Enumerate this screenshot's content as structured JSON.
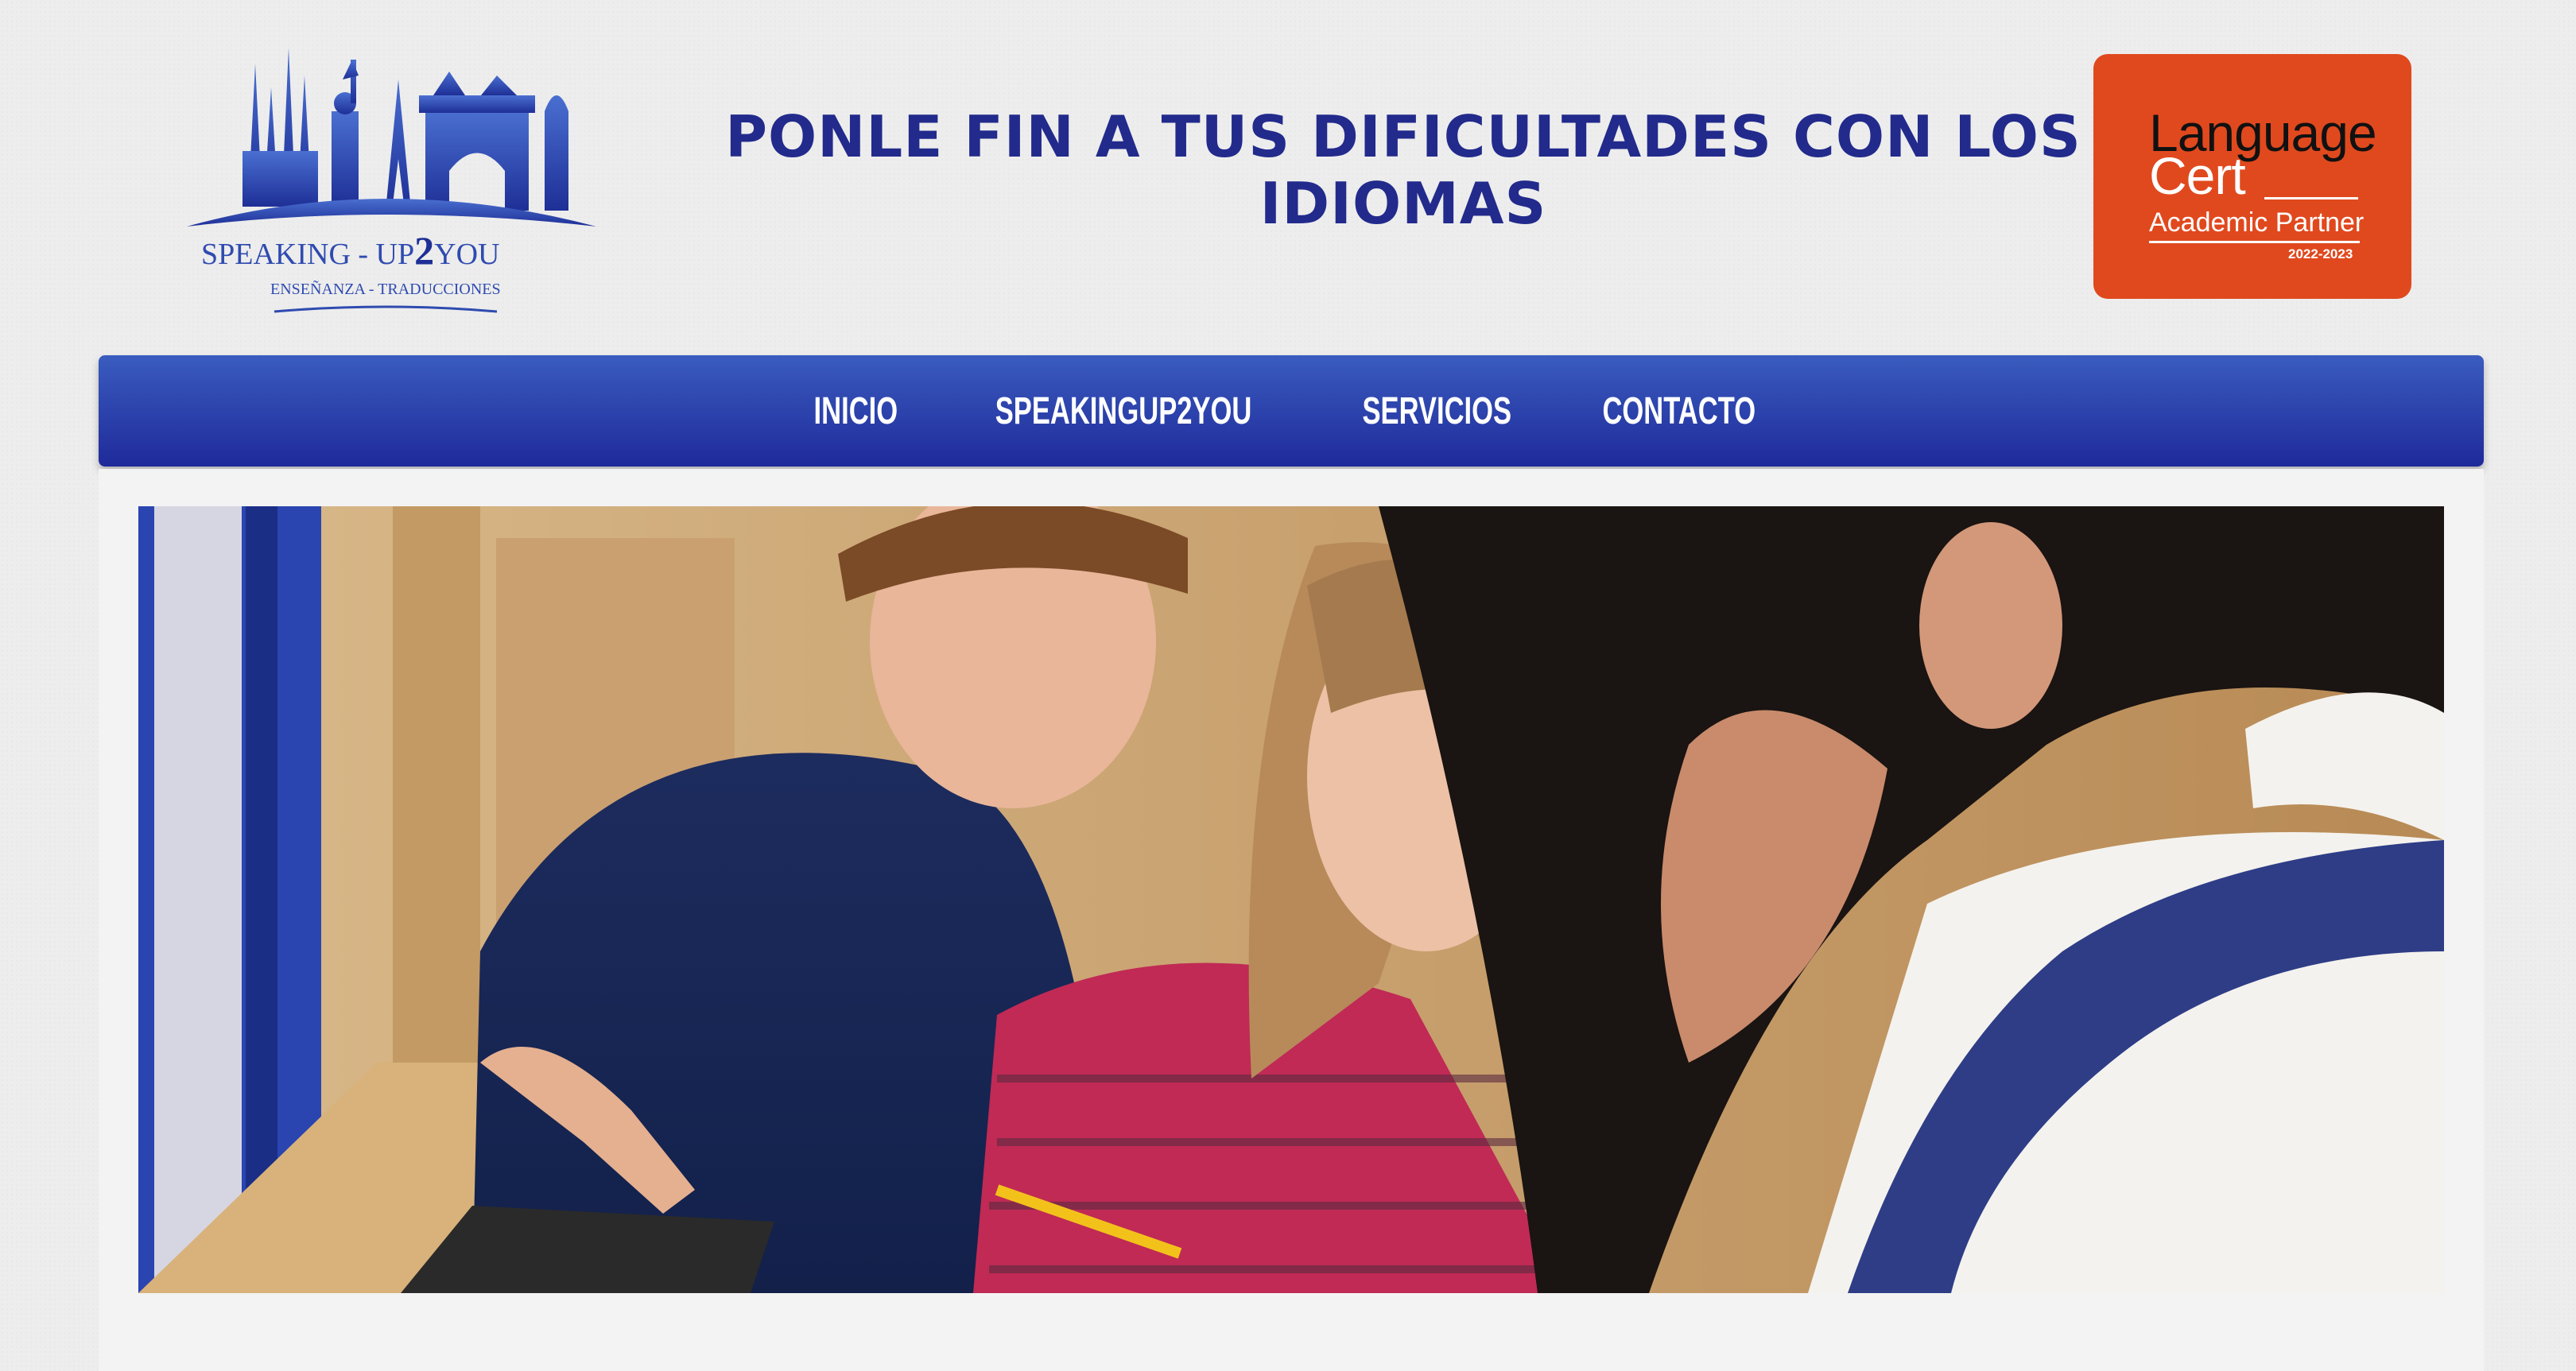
{
  "header": {
    "logo": {
      "name": "SPEAKING - UP2YOU",
      "name_prefix": "SPEAKING - UP",
      "name_number": "2",
      "name_suffix": "YOU",
      "tagline": "ENSEÑANZA - TRADUCCIONES",
      "color": "#2f4bb0"
    },
    "headline_line1": "PONLE FIN A TUS DIFICULTADES CON LOS",
    "headline_line2": "IDIOMAS",
    "badge": {
      "line1": "Language",
      "line2": "Cert",
      "line3": "Academic Partner",
      "line4": "2022-2023",
      "color": "#e0491e"
    }
  },
  "nav": {
    "items": [
      "INICIO",
      "SPEAKINGUP2YOU",
      "SERVICIOS",
      "CONTACTO"
    ],
    "color": "#2a3faa"
  },
  "hero": {
    "image": "children-using-tablet-photo"
  },
  "colors": {
    "background": "#ededed",
    "headline": "#222a8c",
    "nav_top": "#3a5cbf",
    "nav_bottom": "#1f2a9a"
  }
}
